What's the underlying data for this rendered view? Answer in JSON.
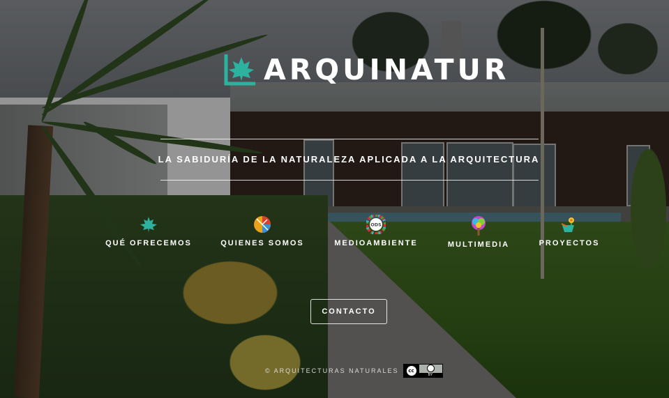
{
  "brand": {
    "name": "ARQUINATUR",
    "accent": "#2bb3a0"
  },
  "tagline": "LA SABIDURÍA DE LA NATURALEZA APLICADA A LA ARQUITECTURA",
  "nav": [
    {
      "label": "QUÉ OFRECEMOS",
      "icon": "maple-leaf-icon"
    },
    {
      "label": "QUIENES SOMOS",
      "icon": "colorful-circle-icon"
    },
    {
      "label": "MEDIOAMBIENTE",
      "icon": "ods-wheel-icon",
      "icon_text": "ODS"
    },
    {
      "label": "MULTIMEDIA",
      "icon": "rainbow-tree-icon"
    },
    {
      "label": "PROYECTOS",
      "icon": "flower-pot-icon"
    }
  ],
  "contact": {
    "label": "CONTACTO"
  },
  "footer": {
    "text": "© ARQUITECTURAS NATURALES",
    "license": {
      "cc": "cc",
      "by": "BY"
    }
  }
}
